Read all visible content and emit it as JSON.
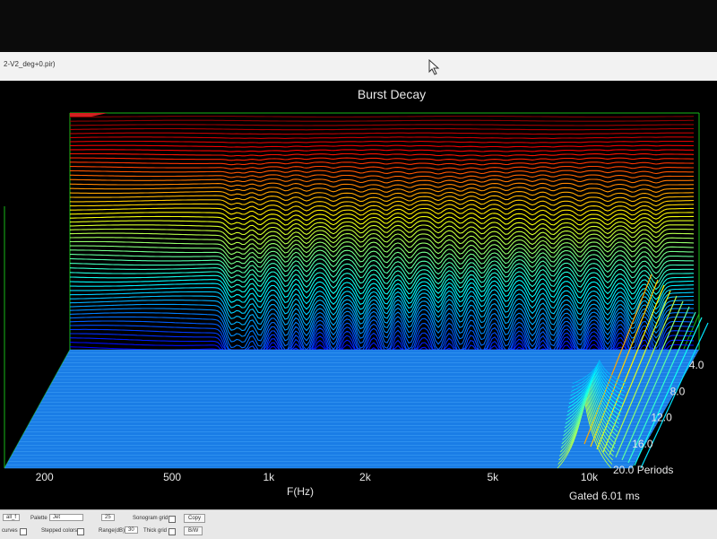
{
  "window": {
    "title": "2-V2_deg+0.pir)"
  },
  "chart_data": {
    "type": "waterfall",
    "title": "Burst Decay",
    "xlabel": "F(Hz)",
    "x_scale": "log",
    "x_ticks": [
      "200",
      "500",
      "1k",
      "2k",
      "5k",
      "10k"
    ],
    "x_tick_values": [
      200,
      500,
      1000,
      2000,
      5000,
      10000
    ],
    "depth_ticks": [
      "4.0",
      "8.0",
      "12.0",
      "16.0",
      "20.0 Periods"
    ],
    "depth_tick_values": [
      4,
      8,
      12,
      16,
      20
    ],
    "depth_unit": "Periods",
    "colormap": "jet",
    "gated_label": "Gated 6.01 ms"
  },
  "controls": {
    "palette_label": "Palette",
    "palette_value": "Jet",
    "left_select_value": "all_f",
    "steps_value": "25",
    "sonogram_grid_label": "Sonogram grid",
    "copy_label": "Copy",
    "curves_label": "curves",
    "stepped_colors_label": "Stepped colors",
    "range_label": "Range(dB)",
    "range_value": "30",
    "thick_grid_label": "Thick grid",
    "bw_label": "B/W"
  }
}
